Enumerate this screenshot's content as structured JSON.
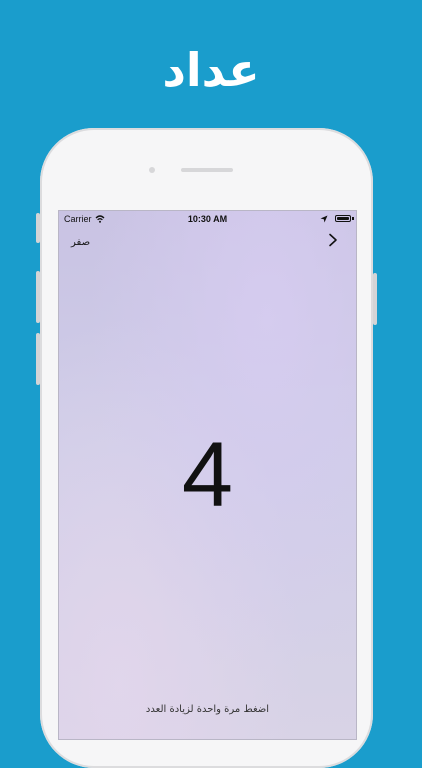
{
  "promo": {
    "title": "عداد"
  },
  "status_bar": {
    "carrier": "Carrier",
    "time": "10:30 AM"
  },
  "nav": {
    "reset_label": "صفر",
    "next_icon": "chevron-right-icon"
  },
  "counter": {
    "value": "4"
  },
  "hint": {
    "text": "اضغط مرة واحدة لزيادة العدد"
  },
  "colors": {
    "background": "#1a9dcc",
    "phone": "#f6f6f7",
    "text": "#111111"
  }
}
